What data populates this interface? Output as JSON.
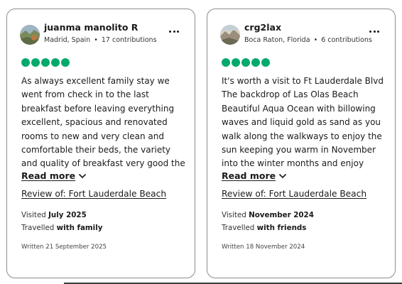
{
  "colors": {
    "rating_bubble": "#00aa6c",
    "border": "#8c8c8c"
  },
  "reviews": [
    {
      "username": "juanma manolito R",
      "location": "Madrid, Spain",
      "separator": "•",
      "contributions": "17 contributions",
      "rating": 5,
      "rating_max": 5,
      "text": "As always excellent family stay we went from check in to the last breakfast before leaving everything excellent, spacious and renovated rooms to new and very clean and comfortable their beds, the variety and quality of breakfast very good the heated pool…",
      "read_more_label": "Read more",
      "review_of_label": "Review of: Fort Lauderdale Beach",
      "visited_prefix": "Visited ",
      "visited_date": "July 2025",
      "travelled_prefix": "Travelled ",
      "travelled_with": "with family",
      "written": "Written 21 September 2025",
      "more_icon": "more-horizontal-icon"
    },
    {
      "username": "crg2lax",
      "location": "Boca Raton, Florida",
      "separator": "•",
      "contributions": "6 contributions",
      "rating": 5,
      "rating_max": 5,
      "text": "It's worth a visit to Ft Lauderdale Blvd The backdrop of Las Olas Beach Beautiful Aqua Ocean with billowing waves and liquid gold as sand as you walk along the walkways to enjoy the sun keeping you warm in November into the winter months and enjoy the…",
      "read_more_label": "Read more",
      "review_of_label": "Review of: Fort Lauderdale Beach",
      "visited_prefix": "Visited ",
      "visited_date": "November 2024",
      "travelled_prefix": "Travelled ",
      "travelled_with": "with friends",
      "written": "Written 18 November 2024",
      "more_icon": "more-horizontal-icon"
    }
  ]
}
